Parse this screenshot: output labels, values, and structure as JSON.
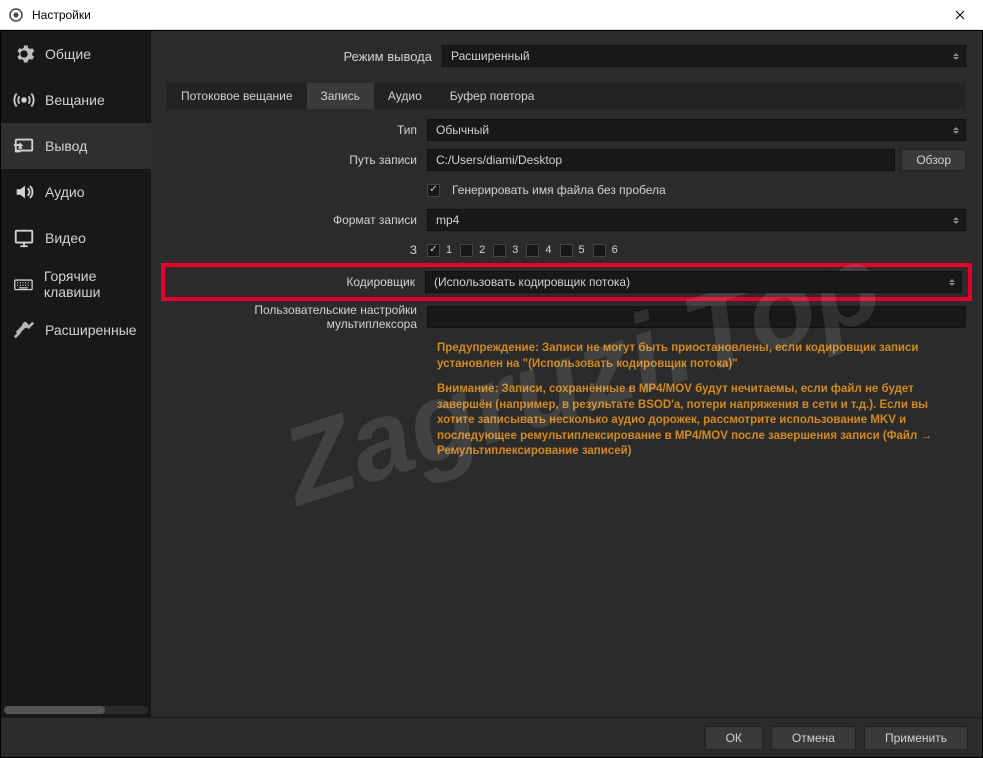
{
  "window": {
    "title": "Настройки"
  },
  "sidebar": {
    "items": [
      {
        "label": "Общие"
      },
      {
        "label": "Вещание"
      },
      {
        "label": "Вывод"
      },
      {
        "label": "Аудио"
      },
      {
        "label": "Видео"
      },
      {
        "label": "Горячие клавиши"
      },
      {
        "label": "Расширенные"
      }
    ]
  },
  "output_mode": {
    "label": "Режим вывода",
    "value": "Расширенный"
  },
  "tabs": [
    {
      "label": "Потоковое вещание"
    },
    {
      "label": "Запись"
    },
    {
      "label": "Аудио"
    },
    {
      "label": "Буфер повтора"
    }
  ],
  "rec": {
    "type_label": "Тип",
    "type_value": "Обычный",
    "path_label": "Путь записи",
    "path_value": "C:/Users/diami/Desktop",
    "browse": "Обзор",
    "gen_label": "Генерировать имя файла без пробела",
    "format_label": "Формат записи",
    "format_value": "mp4",
    "tracks_label": "З",
    "tracks": [
      "1",
      "2",
      "3",
      "4",
      "5",
      "6"
    ],
    "encoder_label": "Кодировщик",
    "encoder_value": "(Использовать кодировщик потока)",
    "mux_label": "Пользовательские настройки мультиплексора"
  },
  "warnings": {
    "w1": "Предупреждение: Записи не могут быть приостановлены, если кодировщик записи установлен на \"(Использовать кодировщик потока)\"",
    "w2": "Внимание: Записи, сохранённые в MP4/MOV будут нечитаемы, если файл не будет завершён (например, в результате BSOD'а, потери напряжения в сети и т.д.). Если вы хотите записывать несколько аудио дорожек, рассмотрите использование MKV и последующее ремультиплексирование в MP4/MOV после завершения записи (Файл → Ремультиплексирование записей)"
  },
  "footer": {
    "ok": "ОК",
    "cancel": "Отмена",
    "apply": "Применить"
  },
  "watermark": "Zagruzi.Top"
}
